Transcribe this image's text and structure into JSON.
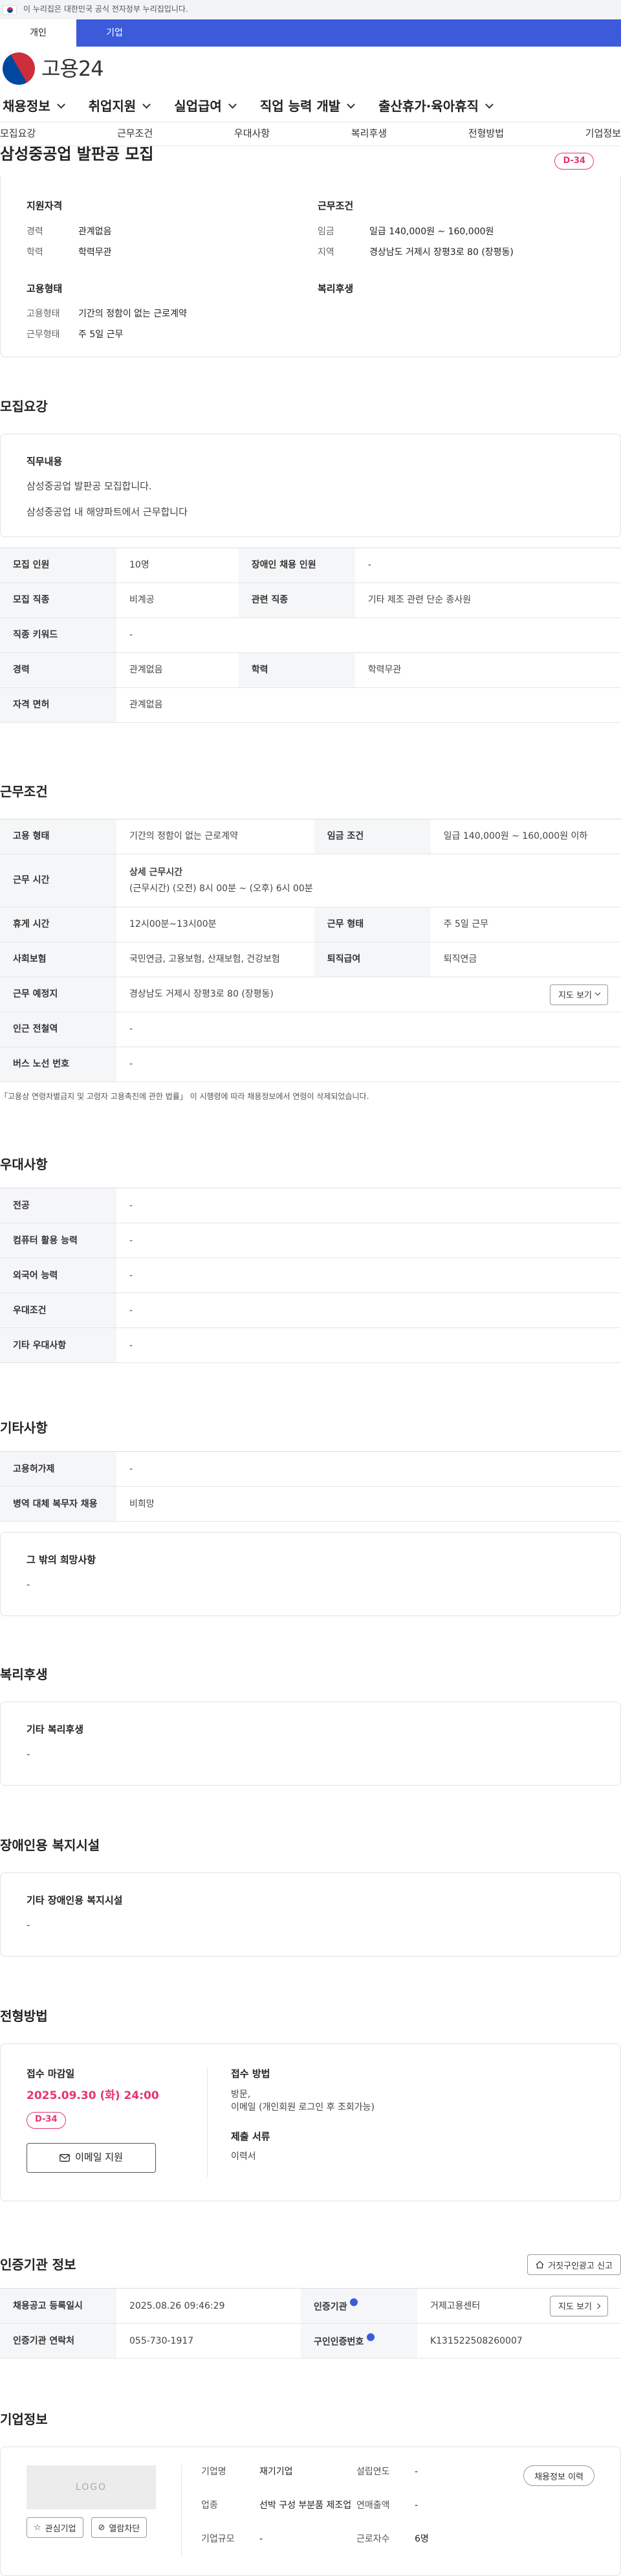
{
  "gov_banner": {
    "text": "이 누리집은 대한민국 공식 전자정부 누리집입니다."
  },
  "portal_tabs": [
    {
      "label": "개인"
    },
    {
      "label": "기업"
    }
  ],
  "logo": {
    "text": "고용24"
  },
  "gnb": [
    {
      "label": "채용정보"
    },
    {
      "label": "취업지원"
    },
    {
      "label": "실업급여"
    },
    {
      "label": "직업 능력 개발"
    },
    {
      "label": "출산휴가·육아휴직"
    }
  ],
  "anchors": [
    {
      "label": "모집요강"
    },
    {
      "label": "근무조건"
    },
    {
      "label": "우대사항"
    },
    {
      "label": "복리후생"
    },
    {
      "label": "전형방법"
    },
    {
      "label": "기업정보"
    }
  ],
  "job": {
    "title": "삼성중공업 발판공 모집",
    "dday": "D-34",
    "qual_head": "지원자격",
    "qual": [
      {
        "k": "경력",
        "v": "관계없음"
      },
      {
        "k": "학력",
        "v": "학력무관"
      }
    ],
    "cond_head": "근무조건",
    "cond": [
      {
        "k": "임금",
        "v": "일급 140,000원 ~ 160,000원"
      },
      {
        "k": "지역",
        "v": "경상남도 거제시 장평3로 80 (장평동)"
      }
    ],
    "emp_head": "고용형태",
    "emp": [
      {
        "k": "고용형태",
        "v": "기간의 정함이 없는 근로계약"
      },
      {
        "k": "근무형태",
        "v": "주 5일 근무"
      }
    ],
    "welfare_head": "복리후생"
  },
  "recruit": {
    "title": "모집요강",
    "duty_head": "직무내용",
    "duty_lines": [
      "삼성중공업 발판공 모집합니다.",
      "삼성중공업 내 해양파트에서 근무합니다"
    ],
    "rows": [
      {
        "k1": "모집 인원",
        "v1": "10명",
        "k2": "장애인 채용 인원",
        "v2": "-"
      },
      {
        "k1": "모집 직종",
        "v1": "비계공",
        "k2": "관련 직종",
        "v2": "기타 제조 관련 단순 종사원"
      },
      {
        "k1": "직종 키워드",
        "v1": "-"
      },
      {
        "k1": "경력",
        "v1": "관계없음",
        "k2": "학력",
        "v2": "학력무관"
      },
      {
        "k1": "자격 면허",
        "v1": "관계없음"
      }
    ]
  },
  "work": {
    "title": "근무조건",
    "r1": {
      "k1": "고용 형태",
      "v1": "기간의 정함이 없는 근로계약",
      "k2": "임금 조건",
      "v2": "일급 140,000원 ~ 160,000원 이하"
    },
    "r2": {
      "k": "근무 시간",
      "head": "상세 근무시간",
      "detail": "(근무시간) (오전) 8시 00분 ~ (오후) 6시 00분"
    },
    "r3": {
      "k1": "휴게 시간",
      "v1": "12시00분~13시00분",
      "k2": "근무 형태",
      "v2": "주 5일 근무"
    },
    "r4": {
      "k1": "사회보험",
      "v1": "국민연금, 고용보험, 산재보험, 건강보험",
      "k2": "퇴직급여",
      "v2": "퇴직연금"
    },
    "r5": {
      "k": "근무 예정지",
      "v": "경상남도 거제시 장평3로 80 (장평동)",
      "btn": "지도 보기"
    },
    "r6": {
      "k": "인근 전철역",
      "v": "-"
    },
    "r7": {
      "k": "버스 노선 번호",
      "v": "-"
    },
    "note": "「고용상 연령차별금지 및 고령자 고용촉진에 관한 법률」 이 시행령에 따라 채용정보에서 연령이 삭제되었습니다."
  },
  "pref": {
    "title": "우대사항",
    "rows": [
      {
        "k": "전공",
        "v": "-"
      },
      {
        "k": "컴퓨터 활용 능력",
        "v": "-"
      },
      {
        "k": "외국어 능력",
        "v": "-"
      },
      {
        "k": "우대조건",
        "v": "-"
      },
      {
        "k": "기타 우대사항",
        "v": "-"
      }
    ]
  },
  "etc": {
    "title": "기타사항",
    "rows": [
      {
        "k": "고용허가제",
        "v": "-"
      },
      {
        "k": "병역 대체 복무자 채용",
        "v": "비희망"
      }
    ],
    "box_head": "그 밖의 희망사항",
    "box_val": "-"
  },
  "welfare": {
    "title": "복리후생",
    "box_head": "기타 복리후생",
    "box_val": "-"
  },
  "facility": {
    "title": "장애인용 복지시설",
    "box_head": "기타 장애인용 복지시설",
    "box_val": "-"
  },
  "selection": {
    "title": "전형방법",
    "deadline_head": "접수 마감일",
    "deadline": "2025.09.30 (화) 24:00",
    "dday": "D-34",
    "email_btn": "이메일 지원",
    "method_head": "접수 방법",
    "method_lines": [
      "방문,",
      "이메일 (개인회원 로그인 후 조회가능)"
    ],
    "docs_head": "제출 서류",
    "docs_val": "이력서"
  },
  "cert": {
    "title": "인증기관 정보",
    "report_btn": "거짓구인광고 신고",
    "r1": {
      "k1": "채용공고 등록일시",
      "v1": "2025.08.26 09:46:29",
      "k2": "인증기관",
      "v2": "거제고용센터",
      "btn": "지도 보기"
    },
    "r2": {
      "k1": "인증기관 연락처",
      "v1": "055-730-1917",
      "k2": "구인인증번호",
      "v2": "K131522508260007"
    }
  },
  "company": {
    "title": "기업정보",
    "logo_placeholder": "LOGO",
    "fav_btn": "관심기업",
    "block_btn": "열람차단",
    "k_name": "기업명",
    "v_name": "재기기업",
    "k_year": "설립연도",
    "v_year": "-",
    "k_ind": "업종",
    "v_ind": "선박 구성 부분품 제조업",
    "k_sales": "연매출액",
    "v_sales": "-",
    "k_emp": "근로자수",
    "v_emp": "6명",
    "k_size": "기업규모",
    "v_size": "-",
    "history_btn": "채용정보 이력"
  },
  "colors": {
    "accent": "#3b5bdb",
    "dday": "#e8356b",
    "info_badge": "#3b5bdb"
  }
}
